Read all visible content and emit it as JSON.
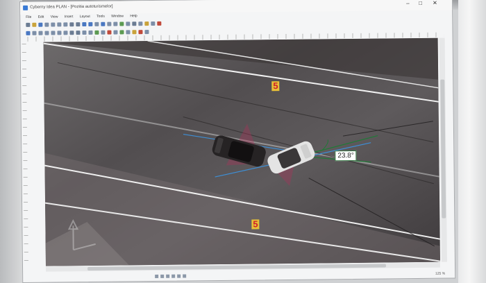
{
  "window": {
    "title": "Cyberny Idea PLAN - [Pozitia autoturismelor]",
    "controls": {
      "minimize": "–",
      "maximize": "□",
      "close": "✕"
    }
  },
  "menubar": {
    "items": [
      "File",
      "Edit",
      "View",
      "Insert",
      "Layout",
      "Tools",
      "Window",
      "Help"
    ]
  },
  "canvas": {
    "lane_labels": [
      "5",
      "5"
    ],
    "angle_label": "23.8°"
  },
  "statusbar": {
    "zoom": "125 %"
  },
  "colors": {
    "lane_label_text": "#d0222a",
    "lane_label_bg": "#e8c037",
    "angle_line": "#1f7a36",
    "impact_zone": "#b0305a",
    "trajectory": "#3d8fd6"
  }
}
